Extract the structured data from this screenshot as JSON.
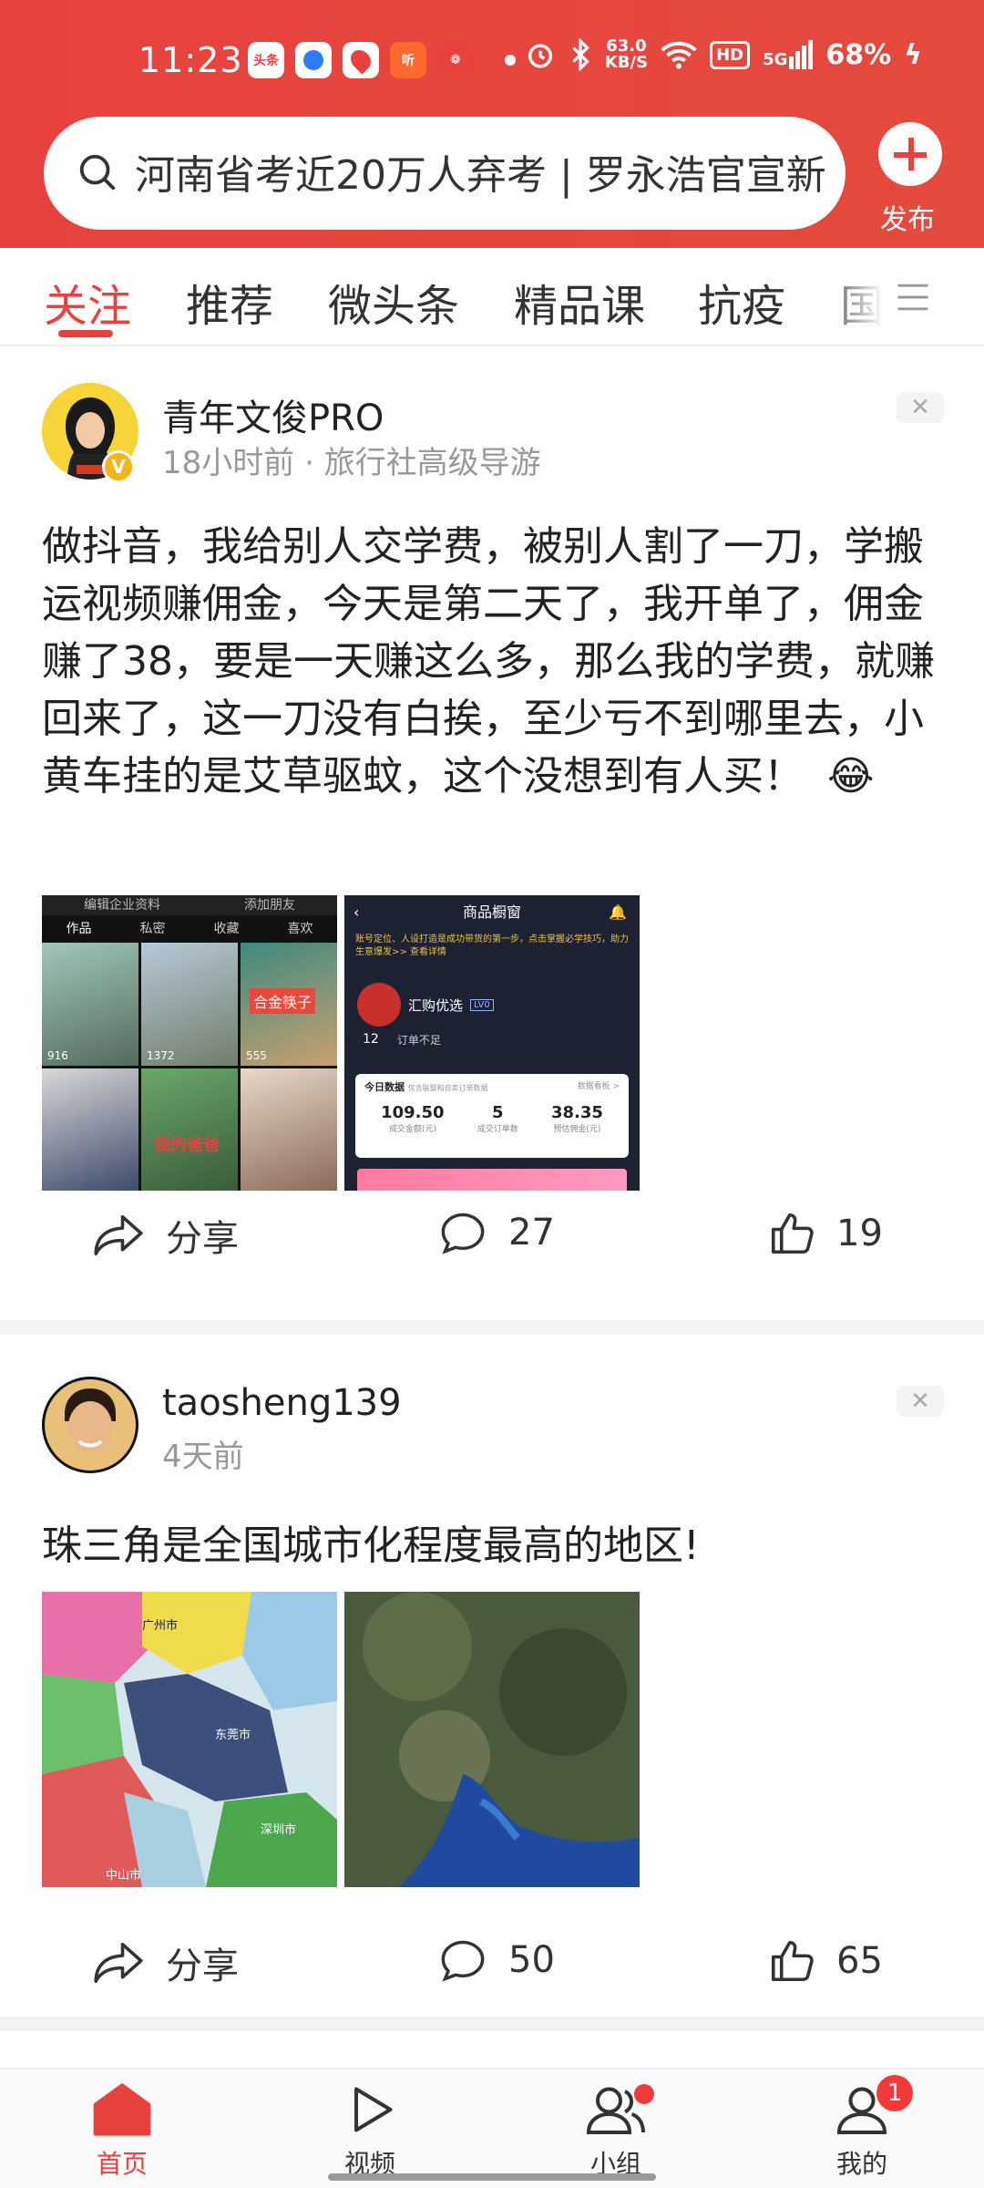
{
  "status_bar": {
    "time": "11:23",
    "net_speed": "63.0",
    "net_unit": "KB/S",
    "hd": "HD",
    "signal": "5G",
    "battery": "68%"
  },
  "search": {
    "query": "河南省考近20万人弃考 | 罗永浩官宣新"
  },
  "publish": {
    "label": "发布"
  },
  "tabs": [
    {
      "label": "关注",
      "active": true
    },
    {
      "label": "推荐"
    },
    {
      "label": "微头条"
    },
    {
      "label": "精品课"
    },
    {
      "label": "抗疫"
    },
    {
      "label": "国"
    }
  ],
  "posts": [
    {
      "author": "青年文俊PRO",
      "meta": "18小时前 · 旅行社高级导游",
      "verified_badge": "V",
      "text": "做抖音，我给别人交学费，被别人割了一刀，学搬运视频赚佣金，今天是第二天了，我开单了，佣金赚了38，要是一天赚这么多，那么我的学费，就赚回来了，这一刀没有白挨，至少亏不到哪里去，小黄车挂的是艾草驱蚊，这个没想到有人买！",
      "emoji": "😂",
      "thumb1": {
        "top_buttons": [
          "编辑企业资料",
          "添加朋友"
        ],
        "tabs": [
          "作品",
          "私密",
          "收藏",
          "喜欢"
        ],
        "video_counts": [
          "916",
          "1372",
          "555"
        ],
        "overlay_text": "合金筷子",
        "overlay_text2": "我的爸爸"
      },
      "thumb2": {
        "title": "商品橱窗",
        "notice": "账号定位、人设打造是成功带货的第一步，点击掌握必学技巧，助力生意爆发>> 查看详情",
        "shop_name": "汇购优选",
        "level": "LV0",
        "stat_value": "12",
        "stat_label": "订单不足",
        "today_label": "今日数据",
        "today_sub": "仅含联盟和自卖订单数据",
        "board_link": "数据看板 >",
        "stats": [
          {
            "value": "109.50",
            "label": "成交金额(元)"
          },
          {
            "value": "5",
            "label": "成交订单数"
          },
          {
            "value": "38.35",
            "label": "预估佣金(元)"
          }
        ]
      },
      "share_label": "分享",
      "comments": "27",
      "likes": "19"
    },
    {
      "author": "taosheng139",
      "meta": "4天前",
      "text": "珠三角是全国城市化程度最高的地区!",
      "map_labels": [
        "广州市",
        "东莞市",
        "深圳市",
        "中山市"
      ],
      "share_label": "分享",
      "comments": "50",
      "likes": "65"
    }
  ],
  "bottom_nav": [
    {
      "label": "首页",
      "active": true
    },
    {
      "label": "视频"
    },
    {
      "label": "小组"
    },
    {
      "label": "我的",
      "badge": "1"
    }
  ],
  "colors": {
    "accent": "#e8423f"
  }
}
